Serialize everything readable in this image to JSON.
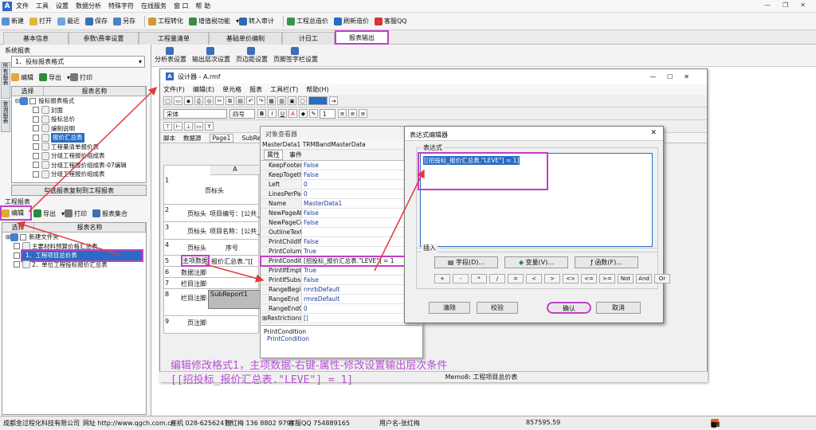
{
  "menubar": {
    "items": [
      "文件",
      "工具",
      "设置",
      "数据分析",
      "特殊字符",
      "在线服务",
      "窗 口",
      "帮 助"
    ]
  },
  "toolbar": {
    "items": [
      "新建",
      "打开",
      "最近",
      "保存",
      "另存",
      "工程转化",
      "增值税功能",
      "转入审计",
      "工程总造价",
      "刷新造价",
      "客服QQ"
    ]
  },
  "tabs": [
    "基本信息",
    "参数\\费率设置",
    "工程量清单",
    "基础单价编制",
    "计日工",
    "报表输出"
  ],
  "left": {
    "system_label": "系统报表",
    "combo": "1、投标报表格式",
    "side_tabs": [
      "所有报表",
      "查询报表"
    ],
    "toolbar": [
      "编辑",
      "导出",
      "打印"
    ],
    "col_select": "选择",
    "col_name": "报表名称",
    "tree1": [
      "投标报表格式",
      "封面",
      "投标总价",
      "编制说明",
      "报价汇总表",
      "工程量清单报价表",
      "分组工程报价组成表",
      "分组工程报价组成表-07编辑",
      "分组工程报价组成表"
    ],
    "batch": "勾选报表复制到工程报表",
    "project_label": "工程报表",
    "toolbar2": [
      "编辑",
      "导出",
      "打印",
      "报表集合"
    ],
    "tree2": [
      "新建文件夹",
      "主要材料预算价格汇总表",
      "1、工程项目总价表",
      "2、单位工程投标报价汇总表"
    ]
  },
  "subtoolbar": [
    "分析表设置",
    "输出层次设置",
    "页边距设置",
    "页脚签字栏设置"
  ],
  "designer": {
    "title": "设计器 - A.rmf",
    "menu": [
      "文件(F)",
      "编辑(E)",
      "单元格",
      "报表",
      "工具栏(T)",
      "帮助(H)"
    ],
    "font": "宋体",
    "size": "四号",
    "linew": "1",
    "tabs": [
      "脚本",
      "数据源",
      "Page1",
      "SubRep"
    ],
    "colA": "A",
    "bands": [
      {
        "n": "1",
        "l": "页标头"
      },
      {
        "n": "2",
        "l": "页标头",
        "t": "项目编号：[公共_"
      },
      {
        "n": "3",
        "l": "页标头",
        "t": "项目名称：[公共_"
      },
      {
        "n": "4",
        "l": "页标头",
        "t": "序号"
      },
      {
        "n": "5",
        "l": "主项数据",
        "t": "报价汇总表.\"[["
      },
      {
        "n": "6",
        "l": "数据注脚"
      },
      {
        "n": "7",
        "l": "栏目注脚"
      },
      {
        "n": "8",
        "l": "栏目注脚",
        "t": "SubReport1"
      },
      {
        "n": "9",
        "l": "页注脚"
      }
    ],
    "status": "Memo8: 工程项目总价表"
  },
  "inspector": {
    "title": "对象查看器",
    "obj": "MasterData1",
    "objtype": "TRMBandMasterData",
    "tabs": [
      "属性",
      "事件"
    ],
    "props": [
      [
        "KeepFooter",
        "False"
      ],
      [
        "KeepTogethe",
        "False"
      ],
      [
        "Left",
        "0"
      ],
      [
        "LinesPerPag",
        "0"
      ],
      [
        "Name",
        "MasterData1"
      ],
      [
        "NewPageAft",
        "False"
      ],
      [
        "NewPageCor",
        "False"
      ],
      [
        "OutlineText",
        ""
      ],
      [
        "PrintChildIfr",
        "False"
      ],
      [
        "PrintColumnF",
        "True"
      ],
      [
        "PrintConditio",
        "[招投标_报价汇总表.\"LEVE\"] = 1"
      ],
      [
        "PrintIfEmpty",
        "True"
      ],
      [
        "PrintIfSubse",
        "False"
      ],
      [
        "RangeBegin",
        "rmrbDefault"
      ],
      [
        "RangeEnd",
        "rmreDefault"
      ],
      [
        "RangeEndCo",
        "0"
      ],
      [
        "Restrictions",
        "[]"
      ]
    ],
    "desc_title": "PrintCondition",
    "desc": "PrintCondition"
  },
  "expr": {
    "title": "表达式编辑器",
    "label": "表达式",
    "value": "[[招投标_报价汇总表.\"LEVE\"] = 1]",
    "insert": "插入",
    "btns": [
      "字段(D)...",
      "变量(V)...",
      "函数(F)..."
    ],
    "ops": [
      "+",
      "-",
      "*",
      "/",
      "=",
      "<",
      ">",
      "<>",
      "<=",
      ">=",
      "Not",
      "And",
      "Or"
    ],
    "clear": "清除",
    "check": "校验",
    "ok": "确认",
    "cancel": "取消"
  },
  "note": {
    "line1": "编辑修改格式1，主项数据-右键-属性-修改设置输出层次条件",
    "line2": "[[招投标_报价汇总表.\"LEVE\"] = 1]"
  },
  "status": {
    "company": "成都金过程化科技有限公司",
    "site": "网址 http://www.qgch.com.cn",
    "phone": "座机 028-62562477",
    "contact": "张红梅 136 8802 9797",
    "qq": "客服QQ 754889165",
    "user": "用户名-张红梅",
    "num": "857595.59"
  },
  "colors": {
    "accent": "#c040c8",
    "select": "#2a6bc4",
    "arrow": "#e23b3b"
  }
}
